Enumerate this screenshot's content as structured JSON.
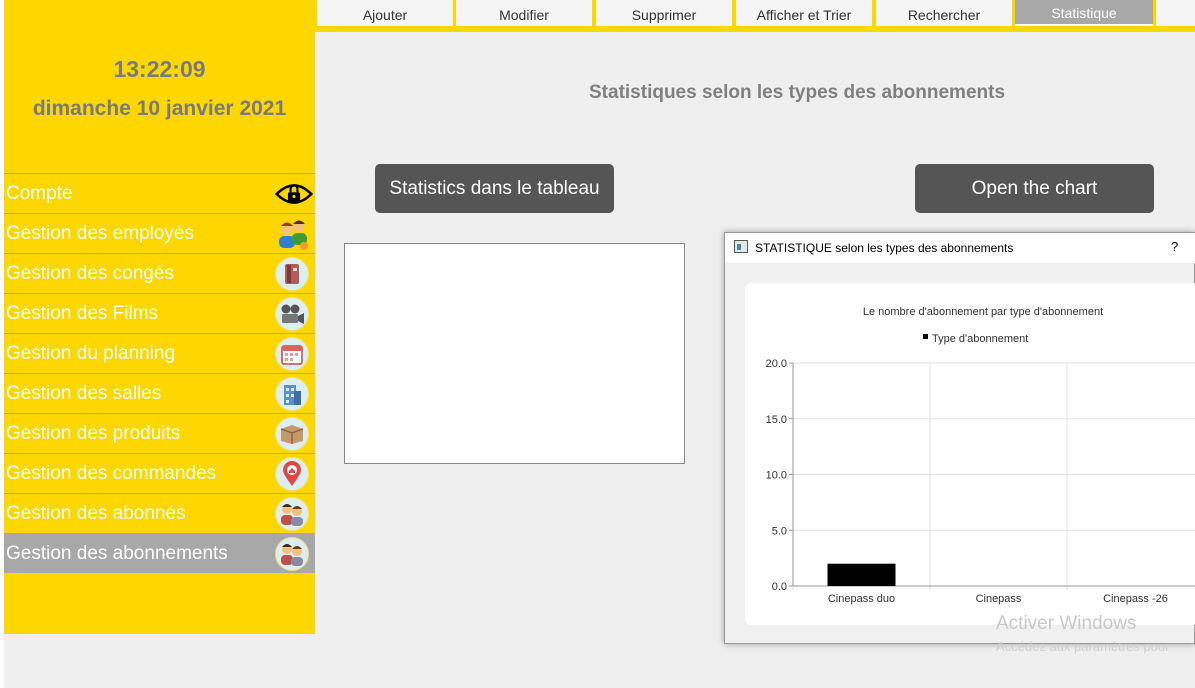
{
  "header": {
    "time": "13:22:09",
    "date": "dimanche 10 janvier 2021",
    "page_title": "Statistiques selon les types des abonnements"
  },
  "tabs": [
    {
      "label": "Ajouter",
      "active": false
    },
    {
      "label": "Modifier",
      "active": false
    },
    {
      "label": "Supprimer",
      "active": false
    },
    {
      "label": "Afficher et Trier",
      "active": false
    },
    {
      "label": "Rechercher",
      "active": false
    },
    {
      "label": "Statistique",
      "active": true
    }
  ],
  "sidebar": {
    "items": [
      {
        "label": "Compte",
        "icon": "lock-eye-icon",
        "active": false
      },
      {
        "label": "Gestion des employés",
        "icon": "employees-icon",
        "active": false
      },
      {
        "label": "Gestion des congés",
        "icon": "book-icon",
        "active": false
      },
      {
        "label": "Gestion des Films",
        "icon": "film-camera-icon",
        "active": false
      },
      {
        "label": "Gestion du planning",
        "icon": "calendar-icon",
        "active": false
      },
      {
        "label": "Gestion des salles",
        "icon": "building-icon",
        "active": false
      },
      {
        "label": "Gestion des produits",
        "icon": "box-icon",
        "active": false
      },
      {
        "label": "Gestion des commandes",
        "icon": "location-pin-icon",
        "active": false
      },
      {
        "label": "Gestion des abonnés",
        "icon": "people-icon",
        "active": false
      },
      {
        "label": "Gestion des abonnements",
        "icon": "people-icon",
        "active": true
      }
    ]
  },
  "buttons": {
    "table": "Statistics dans le tableau",
    "chart": "Open the chart"
  },
  "chart_window": {
    "title": "STATISTIQUE selon les types des abonnements",
    "help": "?"
  },
  "chart_data": {
    "type": "bar",
    "title": "Le nombre d'abonnement par type d'abonnement",
    "legend": [
      "Type d'abonnement"
    ],
    "legend_position": "top",
    "categories": [
      "Cinepass duo",
      "Cinepass",
      "Cinepass -26"
    ],
    "series": [
      {
        "name": "Type d'abonnement",
        "values": [
          2,
          0,
          0
        ],
        "color": "#000000"
      }
    ],
    "ylim": [
      0,
      20
    ],
    "yticks": [
      "20.0",
      "15.0",
      "10.0",
      "5.0",
      "0.0"
    ],
    "grid": true
  },
  "watermark": {
    "line1": "Activer Windows",
    "line2": "Accédez aux paramètres pour"
  },
  "colors": {
    "sidebar": "#ffd700",
    "active": "#a8a8a8",
    "button": "#555555"
  }
}
